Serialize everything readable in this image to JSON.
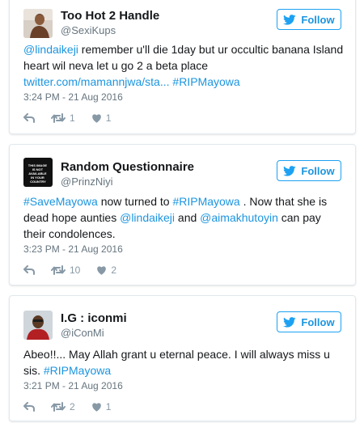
{
  "tweets": [
    {
      "name": "Too Hot 2 Handle",
      "handle": "@SexiKups",
      "follow_label": "Follow",
      "text_parts": [
        {
          "text": "@lindaikeji",
          "link": true
        },
        {
          "text": " remember u'll die 1day but ur occultic banana Island heart wil neva let u go 2 a beta place ",
          "link": false
        },
        {
          "text": "twitter.com/mamannjwa/sta...",
          "link": true
        },
        {
          "text": " ",
          "link": false
        },
        {
          "text": "#RIPMayowa",
          "link": true
        }
      ],
      "timestamp": "3:24 PM - 21 Aug 2016",
      "retweets": "1",
      "likes": "1"
    },
    {
      "name": "Random Questionnaire",
      "handle": "@PrinzNiyi",
      "follow_label": "Follow",
      "avatar_text": "THIS IMAGE IS NOT AVAILABLE IN YOUR COUNTRY",
      "text_parts": [
        {
          "text": "#SaveMayowa",
          "link": true
        },
        {
          "text": " now turned to ",
          "link": false
        },
        {
          "text": "#RIPMayowa",
          "link": true
        },
        {
          "text": " . Now that she is dead hope aunties ",
          "link": false
        },
        {
          "text": "@lindaikeji",
          "link": true
        },
        {
          "text": " and ",
          "link": false
        },
        {
          "text": "@aimakhutoyin",
          "link": true
        },
        {
          "text": " can pay their condolences.",
          "link": false
        }
      ],
      "timestamp": "3:23 PM - 21 Aug 2016",
      "retweets": "10",
      "likes": "2"
    },
    {
      "name": "I.G : iconmi",
      "handle": "@iConMi",
      "follow_label": "Follow",
      "text_parts": [
        {
          "text": "Abeo!!... May Allah grant u eternal peace. I will always miss u sis. ",
          "link": false
        },
        {
          "text": "#RIPMayowa",
          "link": true
        }
      ],
      "timestamp": "3:21 PM - 21 Aug 2016",
      "retweets": "2",
      "likes": "1"
    }
  ],
  "icons": {
    "follow": "twitter-bird-icon",
    "reply": "reply-icon",
    "retweet": "retweet-icon",
    "like": "heart-icon"
  },
  "colors": {
    "link": "#1b95e0",
    "follow_border": "#1da1f2",
    "meta_text": "#66757f",
    "action_icons": "#8899a6"
  }
}
